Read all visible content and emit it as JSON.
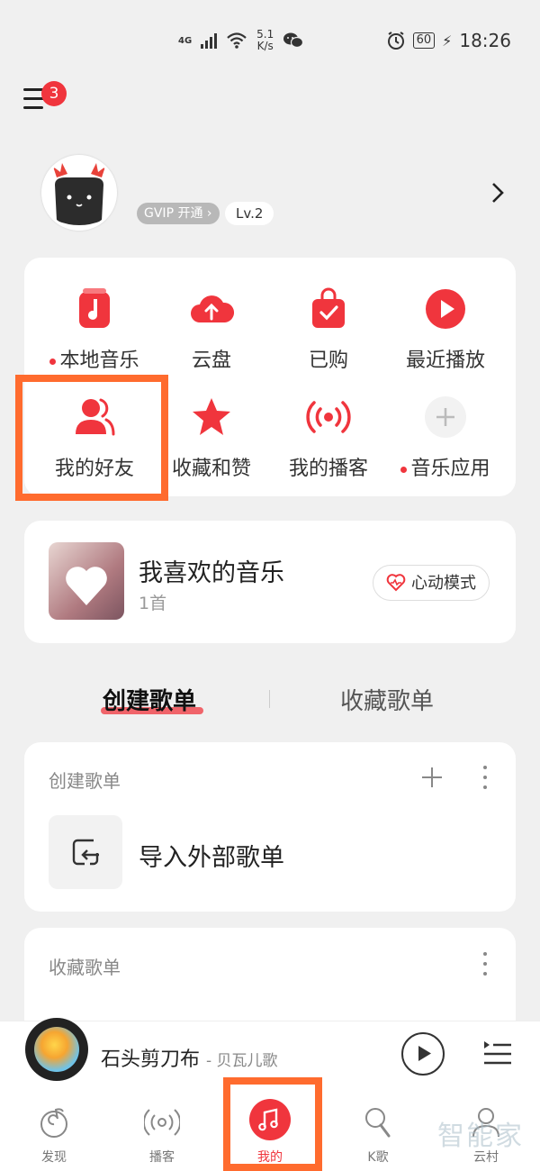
{
  "status_bar": {
    "network": "4G",
    "speed_value": "5.1",
    "speed_unit": "K/s",
    "battery": "60",
    "time": "18:26"
  },
  "header": {
    "menu_badge_count": "3"
  },
  "profile": {
    "vip_label": "VIP 开通",
    "vip_prefix": "G",
    "level": "Lv.2"
  },
  "quick_grid": [
    {
      "label": "本地音乐",
      "dot": true,
      "icon": "music-note-icon"
    },
    {
      "label": "云盘",
      "dot": false,
      "icon": "cloud-upload-icon"
    },
    {
      "label": "已购",
      "dot": false,
      "icon": "shopping-bag-icon"
    },
    {
      "label": "最近播放",
      "dot": false,
      "icon": "play-circle-icon"
    },
    {
      "label": "我的好友",
      "dot": false,
      "icon": "friends-icon"
    },
    {
      "label": "收藏和赞",
      "dot": false,
      "icon": "star-icon"
    },
    {
      "label": "我的播客",
      "dot": false,
      "icon": "broadcast-icon"
    },
    {
      "label": "音乐应用",
      "dot": true,
      "icon": "plus-icon"
    }
  ],
  "liked_music": {
    "title": "我喜欢的音乐",
    "count": "1首",
    "heart_mode_label": "心动模式"
  },
  "tabs": {
    "created": "创建歌单",
    "collected": "收藏歌单"
  },
  "created_section": {
    "label": "创建歌单",
    "import_label": "导入外部歌单"
  },
  "collected_section": {
    "label": "收藏歌单"
  },
  "player": {
    "song": "石头剪刀布",
    "artist": "- 贝瓦儿歌"
  },
  "bottom_nav": [
    {
      "label": "发现",
      "icon": "discover-icon",
      "active": false
    },
    {
      "label": "播客",
      "icon": "podcast-icon",
      "active": false
    },
    {
      "label": "我的",
      "icon": "mine-music-icon",
      "active": true
    },
    {
      "label": "K歌",
      "icon": "microphone-icon",
      "active": false
    },
    {
      "label": "云村",
      "icon": "community-icon",
      "active": false
    }
  ],
  "watermark": "智能家",
  "colors": {
    "accent": "#f0353d",
    "highlight_box": "#ff6b2e",
    "background": "#f0f0f0"
  }
}
